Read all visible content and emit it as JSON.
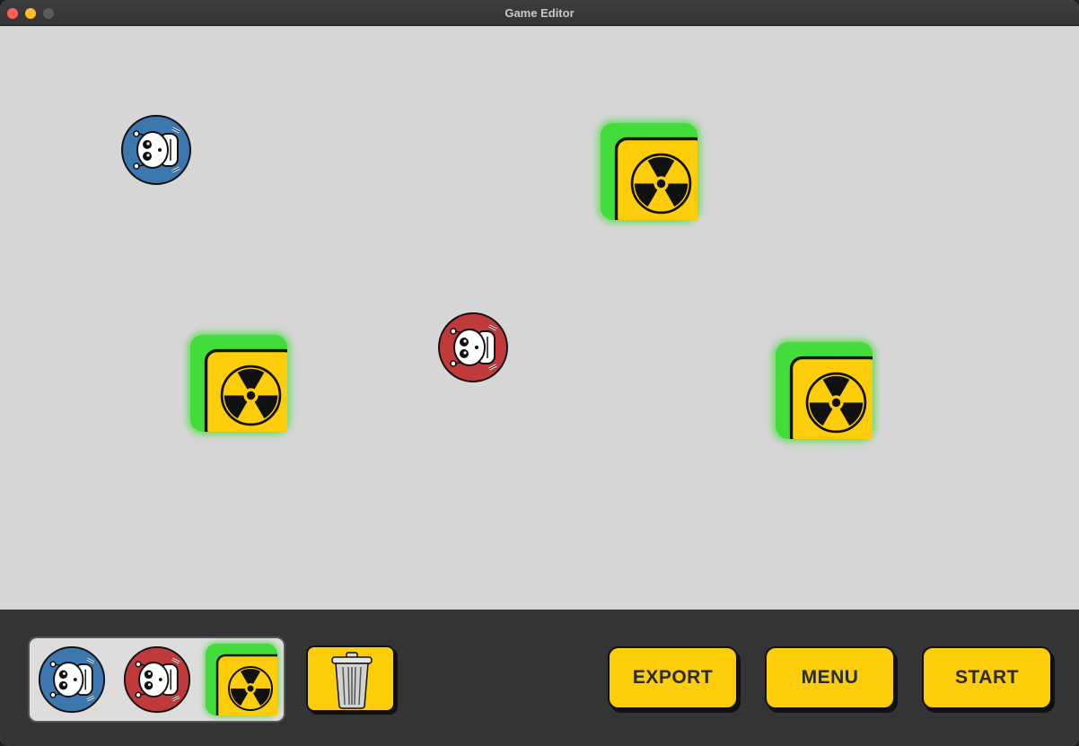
{
  "window": {
    "title": "Game Editor",
    "traffic_lights": [
      "close",
      "minimize",
      "maximize"
    ]
  },
  "canvas": {
    "background": "#d6d6d6",
    "entities": [
      {
        "kind": "robot",
        "team": "blue",
        "color": "#3d77b0",
        "icon": "robot-icon"
      },
      {
        "kind": "hazard",
        "icon": "radiation-icon",
        "highlight": "#42dd3a"
      },
      {
        "kind": "hazard",
        "icon": "radiation-icon",
        "highlight": "#42dd3a"
      },
      {
        "kind": "robot",
        "team": "red",
        "color": "#c0393b",
        "icon": "robot-icon"
      },
      {
        "kind": "hazard",
        "icon": "radiation-icon",
        "highlight": "#42dd3a"
      }
    ]
  },
  "toolbar": {
    "palette": [
      {
        "kind": "robot",
        "team": "blue",
        "icon": "robot-icon"
      },
      {
        "kind": "robot",
        "team": "red",
        "icon": "robot-icon"
      },
      {
        "kind": "hazard",
        "icon": "radiation-icon",
        "selected": true
      }
    ],
    "trash_icon": "trash-can-icon",
    "export_label": "EXPORT",
    "menu_label": "MENU",
    "start_label": "START"
  },
  "colors": {
    "button_yellow": "#fdcd0a",
    "toolbar_bg": "#333433",
    "selection_green": "#42dd3a",
    "robot_blue": "#3d77b0",
    "robot_red": "#c0393b"
  }
}
